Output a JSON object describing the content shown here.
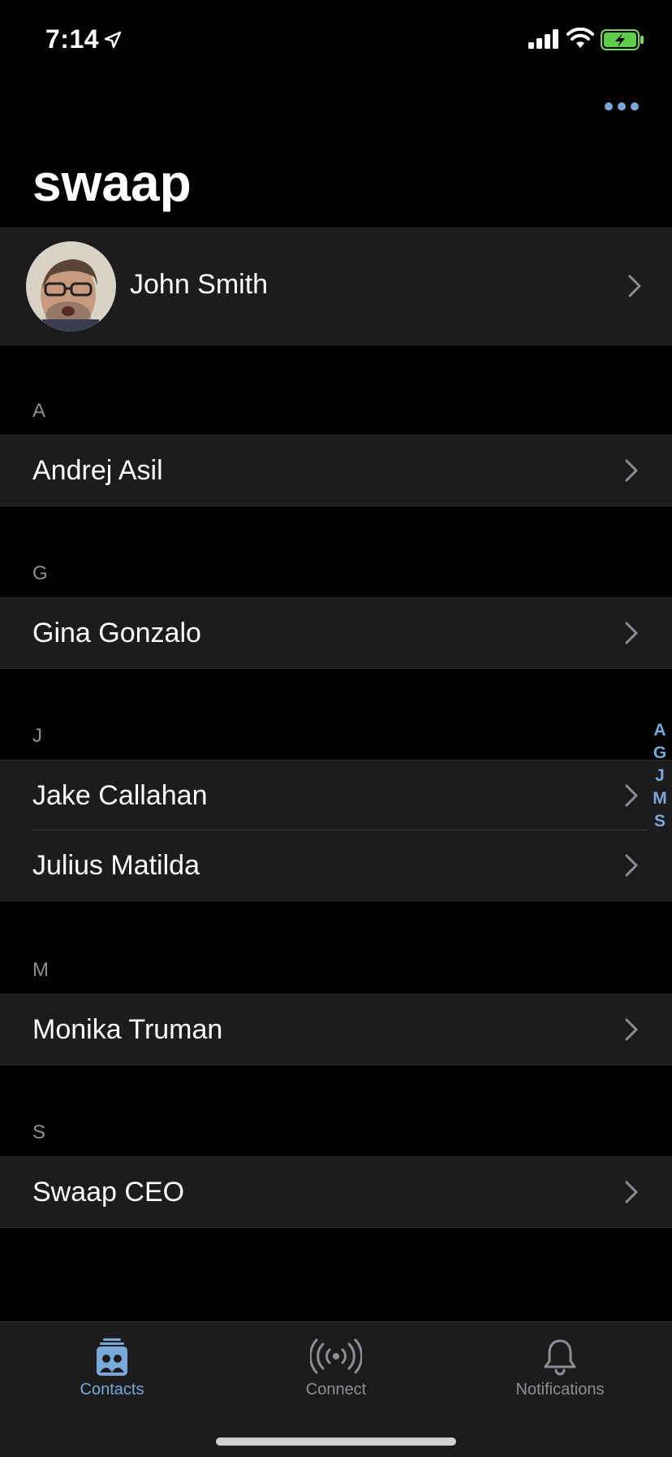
{
  "status_bar": {
    "time": "7:14"
  },
  "header": {
    "title": "swaap"
  },
  "profile": {
    "name": "John Smith"
  },
  "sections": [
    {
      "letter": "A",
      "contacts": [
        "Andrej Asil"
      ]
    },
    {
      "letter": "G",
      "contacts": [
        "Gina Gonzalo"
      ]
    },
    {
      "letter": "J",
      "contacts": [
        "Jake Callahan",
        "Julius Matilda"
      ]
    },
    {
      "letter": "M",
      "contacts": [
        "Monika Truman"
      ]
    },
    {
      "letter": "S",
      "contacts": [
        "Swaap CEO"
      ]
    }
  ],
  "index_bar": [
    "A",
    "G",
    "J",
    "M",
    "S"
  ],
  "tabs": [
    {
      "label": "Contacts",
      "icon": "contacts-icon",
      "active": true
    },
    {
      "label": "Connect",
      "icon": "broadcast-icon",
      "active": false
    },
    {
      "label": "Notifications",
      "icon": "bell-icon",
      "active": false
    }
  ],
  "colors": {
    "accent": "#7aa8d8",
    "background": "#000000",
    "row": "#1c1c1e",
    "inactive": "#8e8e93"
  }
}
